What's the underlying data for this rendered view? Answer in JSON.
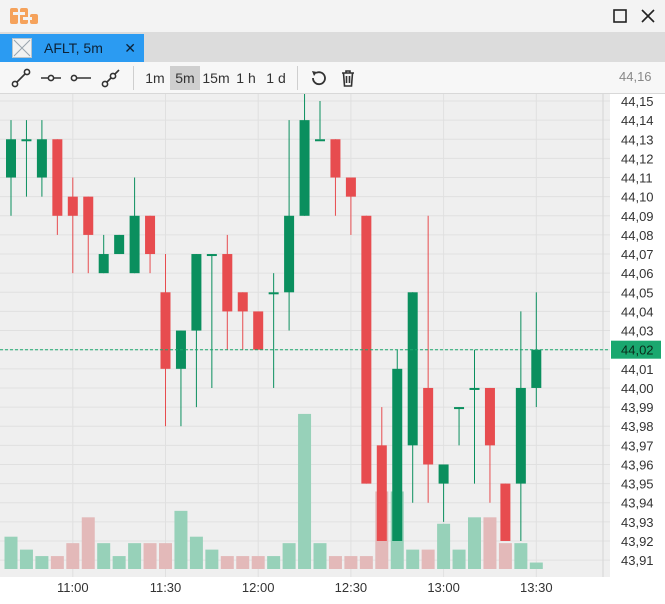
{
  "window": {
    "logo_icon": "app-logo-icon",
    "maximize_icon": "maximize-icon",
    "close_icon": "close-icon"
  },
  "tab": {
    "label": "AFLT, 5m",
    "icon": "chart-thumbnail-icon",
    "close_icon": "close-icon"
  },
  "toolbar": {
    "drawing_tools": [
      {
        "name": "trend-line-tool-icon"
      },
      {
        "name": "horizontal-ray-tool-icon"
      },
      {
        "name": "horizontal-line-tool-icon"
      },
      {
        "name": "ray-tool-icon"
      }
    ],
    "intervals": [
      {
        "label": "1m",
        "active": false
      },
      {
        "label": "5m",
        "active": true
      },
      {
        "label": "15m",
        "active": false
      },
      {
        "label": "1 h",
        "active": false
      },
      {
        "label": "1 d",
        "active": false
      }
    ],
    "reset_icon": "reset-icon",
    "delete_icon": "trash-icon"
  },
  "colors": {
    "up": "#0a8f5e",
    "down": "#e74c4f",
    "up_volume": "#97d1b9",
    "down_volume": "#e3b9b9",
    "grid": "#e0e0e0",
    "chart_bg": "#efefef",
    "price_tag_bg": "#1aa86f",
    "current_line": "#1aa86f"
  },
  "chart_data": {
    "type": "candlestick",
    "symbol": "AFLT",
    "interval": "5m",
    "current_price": "44,02",
    "y_ticks": [
      "44,16",
      "44,15",
      "44,14",
      "44,13",
      "44,12",
      "44,11",
      "44,10",
      "44,09",
      "44,08",
      "44,07",
      "44,06",
      "44,05",
      "44,04",
      "44,03",
      "44,02",
      "44,01",
      "44,00",
      "43,99",
      "43,98",
      "43,97",
      "43,96",
      "43,95",
      "43,94",
      "43,93",
      "43,92",
      "43,91"
    ],
    "ylim": [
      43.905,
      44.155
    ],
    "x_ticks": [
      "11:00",
      "11:30",
      "12:00",
      "12:30",
      "13:00",
      "13:30"
    ],
    "candles": [
      {
        "open": 44.11,
        "high": 44.14,
        "low": 44.09,
        "close": 44.13
      },
      {
        "open": 44.13,
        "high": 44.14,
        "low": 44.1,
        "close": 44.13
      },
      {
        "open": 44.11,
        "high": 44.14,
        "low": 44.1,
        "close": 44.13
      },
      {
        "open": 44.13,
        "high": 44.13,
        "low": 44.08,
        "close": 44.09
      },
      {
        "open": 44.1,
        "high": 44.11,
        "low": 44.06,
        "close": 44.09
      },
      {
        "open": 44.1,
        "high": 44.1,
        "low": 44.06,
        "close": 44.08
      },
      {
        "open": 44.06,
        "high": 44.08,
        "low": 44.06,
        "close": 44.07
      },
      {
        "open": 44.07,
        "high": 44.08,
        "low": 44.07,
        "close": 44.08
      },
      {
        "open": 44.06,
        "high": 44.11,
        "low": 44.06,
        "close": 44.09
      },
      {
        "open": 44.09,
        "high": 44.09,
        "low": 44.06,
        "close": 44.07
      },
      {
        "open": 44.05,
        "high": 44.07,
        "low": 43.98,
        "close": 44.01
      },
      {
        "open": 44.01,
        "high": 44.03,
        "low": 43.98,
        "close": 44.03
      },
      {
        "open": 44.03,
        "high": 44.07,
        "low": 43.99,
        "close": 44.07
      },
      {
        "open": 44.07,
        "high": 44.07,
        "low": 44.0,
        "close": 44.07
      },
      {
        "open": 44.07,
        "high": 44.08,
        "low": 44.02,
        "close": 44.04
      },
      {
        "open": 44.05,
        "high": 44.05,
        "low": 44.02,
        "close": 44.04
      },
      {
        "open": 44.04,
        "high": 44.04,
        "low": 44.02,
        "close": 44.02
      },
      {
        "open": 44.05,
        "high": 44.06,
        "low": 44.0,
        "close": 44.05
      },
      {
        "open": 44.05,
        "high": 44.14,
        "low": 44.03,
        "close": 44.09
      },
      {
        "open": 44.09,
        "high": 44.16,
        "low": 44.09,
        "close": 44.14
      },
      {
        "open": 44.13,
        "high": 44.15,
        "low": 44.13,
        "close": 44.13
      },
      {
        "open": 44.13,
        "high": 44.13,
        "low": 44.09,
        "close": 44.11
      },
      {
        "open": 44.11,
        "high": 44.11,
        "low": 44.08,
        "close": 44.1
      },
      {
        "open": 44.09,
        "high": 44.09,
        "low": 43.95,
        "close": 43.95
      },
      {
        "open": 43.97,
        "high": 43.99,
        "low": 43.92,
        "close": 43.92
      },
      {
        "open": 43.92,
        "high": 44.02,
        "low": 43.92,
        "close": 44.01
      },
      {
        "open": 43.97,
        "high": 44.05,
        "low": 43.94,
        "close": 44.05
      },
      {
        "open": 44.0,
        "high": 44.09,
        "low": 43.94,
        "close": 43.96
      },
      {
        "open": 43.95,
        "high": 43.96,
        "low": 43.93,
        "close": 43.96
      },
      {
        "open": 43.99,
        "high": 43.99,
        "low": 43.97,
        "close": 43.99
      },
      {
        "open": 44.0,
        "high": 44.02,
        "low": 43.95,
        "close": 44.0
      },
      {
        "open": 44.0,
        "high": 44.0,
        "low": 43.94,
        "close": 43.97
      },
      {
        "open": 43.95,
        "high": 43.95,
        "low": 43.92,
        "close": 43.92
      },
      {
        "open": 43.95,
        "high": 44.04,
        "low": 43.92,
        "close": 44.0
      },
      {
        "open": 44.0,
        "high": 44.05,
        "low": 43.99,
        "close": 44.02
      }
    ],
    "volumes": [
      5,
      3,
      2,
      2,
      4,
      8,
      4,
      2,
      4,
      4,
      4,
      9,
      5,
      3,
      2,
      2,
      2,
      2,
      4,
      24,
      4,
      2,
      2,
      2,
      12,
      12,
      3,
      3,
      7,
      3,
      8,
      8,
      4,
      4,
      1
    ],
    "volume_max": 26,
    "volume_axis_share": 0.35,
    "grid": true
  }
}
